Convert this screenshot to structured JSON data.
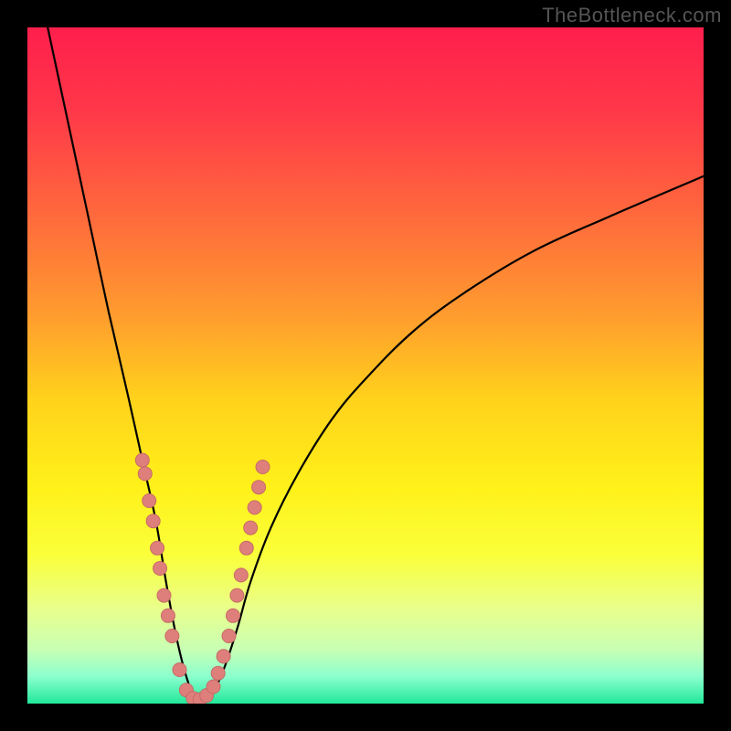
{
  "watermark": "TheBottleneck.com",
  "colors": {
    "frame": "#000000",
    "curve": "#000000",
    "dot_fill": "#df7f7b",
    "dot_stroke": "#c66b67",
    "gradient_stops": [
      {
        "offset": 0.0,
        "color": "#ff1f4c"
      },
      {
        "offset": 0.12,
        "color": "#ff3749"
      },
      {
        "offset": 0.28,
        "color": "#ff6a3c"
      },
      {
        "offset": 0.42,
        "color": "#ff9a2f"
      },
      {
        "offset": 0.55,
        "color": "#ffd21b"
      },
      {
        "offset": 0.68,
        "color": "#fff11a"
      },
      {
        "offset": 0.78,
        "color": "#faff3a"
      },
      {
        "offset": 0.86,
        "color": "#e9ff8c"
      },
      {
        "offset": 0.92,
        "color": "#c8ffb4"
      },
      {
        "offset": 0.96,
        "color": "#8cffce"
      },
      {
        "offset": 1.0,
        "color": "#22e89a"
      }
    ]
  },
  "chart_data": {
    "type": "line",
    "title": "",
    "xlabel": "",
    "ylabel": "",
    "xlim": [
      0,
      100
    ],
    "ylim": [
      0,
      100
    ],
    "note": "V-shaped bottleneck curve. y≈0 at minimum near x≈25; steep left arm rising to y≈100 at x≈3; shallower right arm rising to y≈78 at x≈100.",
    "series": [
      {
        "name": "bottleneck-curve",
        "x": [
          3,
          6,
          9,
          12,
          15,
          17,
          19,
          20.5,
          22,
          23.5,
          25,
          27,
          29,
          31,
          33,
          36,
          40,
          45,
          50,
          57,
          65,
          75,
          86,
          100
        ],
        "y": [
          100,
          86,
          72,
          58,
          45,
          36,
          27,
          18,
          10,
          4,
          0.5,
          1,
          5,
          11,
          18,
          26,
          34,
          42,
          48,
          55,
          61,
          67,
          72,
          78
        ]
      }
    ],
    "scatter": {
      "name": "sample-points",
      "points": [
        {
          "x": 17.0,
          "y": 36
        },
        {
          "x": 17.4,
          "y": 34
        },
        {
          "x": 18.0,
          "y": 30
        },
        {
          "x": 18.6,
          "y": 27
        },
        {
          "x": 19.2,
          "y": 23
        },
        {
          "x": 19.6,
          "y": 20
        },
        {
          "x": 20.2,
          "y": 16
        },
        {
          "x": 20.8,
          "y": 13
        },
        {
          "x": 21.4,
          "y": 10
        },
        {
          "x": 22.5,
          "y": 5
        },
        {
          "x": 23.5,
          "y": 2
        },
        {
          "x": 24.5,
          "y": 0.8
        },
        {
          "x": 25.5,
          "y": 0.6
        },
        {
          "x": 26.5,
          "y": 1.2
        },
        {
          "x": 27.5,
          "y": 2.5
        },
        {
          "x": 28.2,
          "y": 4.5
        },
        {
          "x": 29.0,
          "y": 7
        },
        {
          "x": 29.8,
          "y": 10
        },
        {
          "x": 30.4,
          "y": 13
        },
        {
          "x": 31.0,
          "y": 16
        },
        {
          "x": 31.6,
          "y": 19
        },
        {
          "x": 32.4,
          "y": 23
        },
        {
          "x": 33.0,
          "y": 26
        },
        {
          "x": 33.6,
          "y": 29
        },
        {
          "x": 34.2,
          "y": 32
        },
        {
          "x": 34.8,
          "y": 35
        }
      ]
    }
  }
}
